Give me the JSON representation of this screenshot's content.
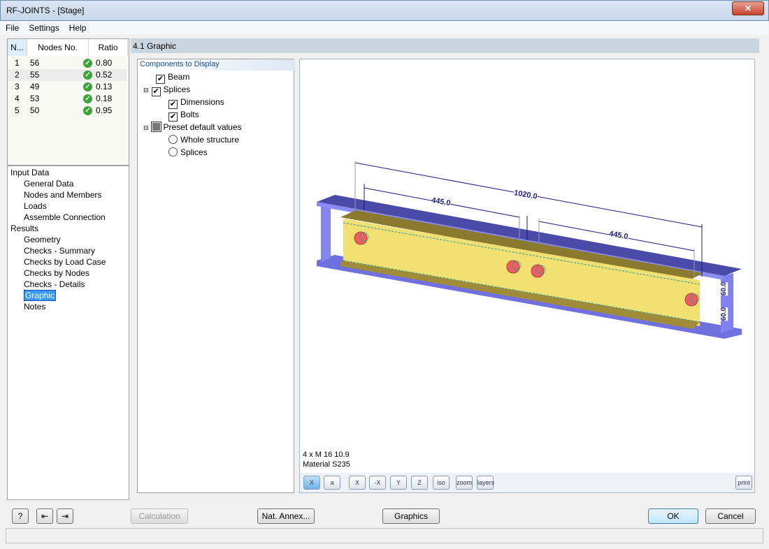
{
  "window": {
    "title": "RF-JOINTS - [Stage]",
    "close": "✕"
  },
  "menu": [
    "File",
    "Settings",
    "Help"
  ],
  "nodes_table": {
    "columns": [
      "N...",
      "Nodes No.",
      "Ratio"
    ],
    "rows": [
      {
        "n": "1",
        "node": "56",
        "ratio": "0.80"
      },
      {
        "n": "2",
        "node": "55",
        "ratio": "0.52"
      },
      {
        "n": "3",
        "node": "49",
        "ratio": "0.13"
      },
      {
        "n": "4",
        "node": "53",
        "ratio": "0.18"
      },
      {
        "n": "5",
        "node": "50",
        "ratio": "0.95"
      }
    ]
  },
  "nav": {
    "input_data": "Input Data",
    "input_items": [
      "General Data",
      "Nodes and Members",
      "Loads",
      "Assemble Connection"
    ],
    "results": "Results",
    "result_items": [
      "Geometry",
      "Checks - Summary",
      "Checks by Load Case",
      "Checks by Nodes",
      "Checks - Details",
      "Graphic",
      "Notes"
    ],
    "selected": "Graphic"
  },
  "section_title": "4.1 Graphic",
  "components": {
    "title": "Components to Display",
    "beam": "Beam",
    "splices": "Splices",
    "dimensions": "Dimensions",
    "bolts": "Bolts",
    "preset": "Preset default values",
    "whole": "Whole structure",
    "splices_opt": "Splices"
  },
  "graphic": {
    "dims": {
      "total": "1020.0",
      "left": "445.0",
      "right": "445.0",
      "v1": "60.0",
      "v2": "60.0"
    },
    "info1": "4 x M 16 10.9",
    "info2": "Material S235",
    "toolbar": [
      "X",
      "a",
      "X",
      "-X",
      "Y",
      "Z",
      "iso",
      "zoom",
      "layers",
      "print"
    ],
    "colors": {
      "beam": "#7b7be8",
      "splice": "#f2df74",
      "bolt": "#e86060",
      "dim": "#1a1a80"
    }
  },
  "buttons": {
    "calculation": "Calculation",
    "nat_annex": "Nat. Annex...",
    "graphics": "Graphics",
    "ok": "OK",
    "cancel": "Cancel"
  }
}
